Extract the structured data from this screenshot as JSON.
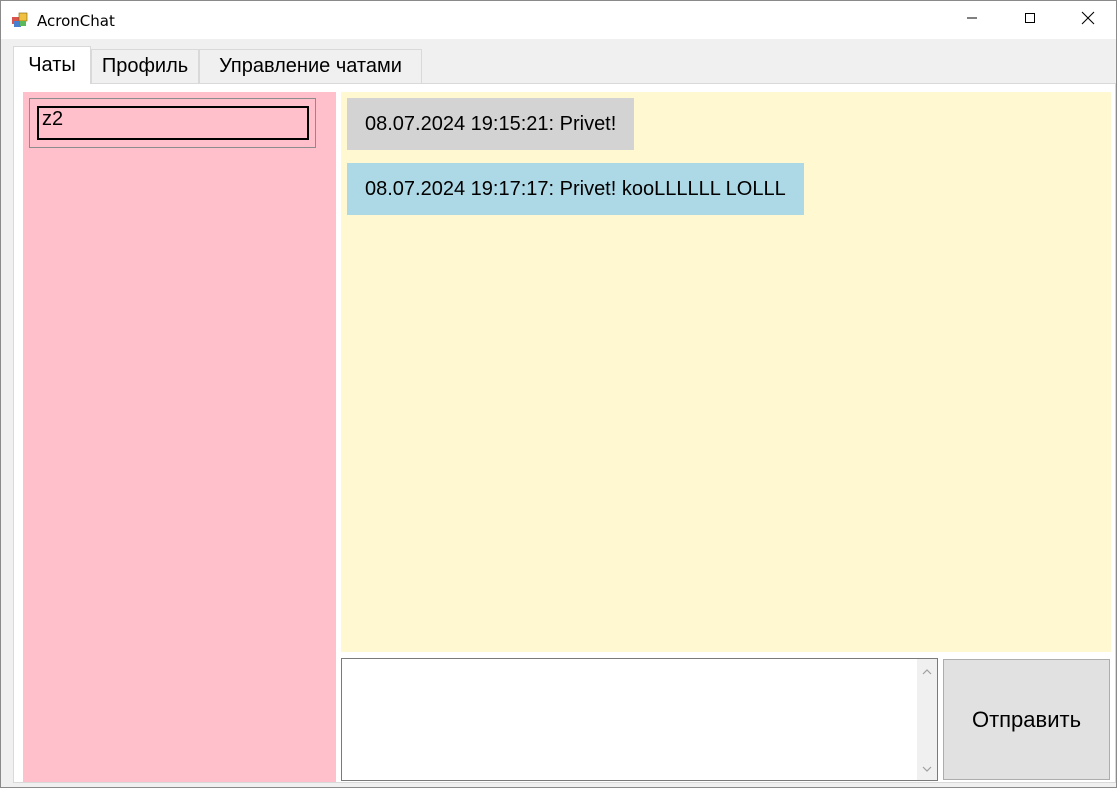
{
  "window": {
    "title": "AcronChat",
    "controls": {
      "minimize_icon": "minimize-icon",
      "maximize_icon": "maximize-icon",
      "close_icon": "close-icon"
    }
  },
  "tabs": [
    {
      "label": "Чаты",
      "active": true
    },
    {
      "label": "Профиль",
      "active": false
    },
    {
      "label": "Управление чатами",
      "active": false
    }
  ],
  "chat_list": {
    "background": "#ffc0cb",
    "items": [
      {
        "label": "z2"
      }
    ]
  },
  "messages": {
    "background": "#fff8d0",
    "items": [
      {
        "text": "08.07.2024 19:15:21: Privet!",
        "color": "#d3d3d3"
      },
      {
        "text": "08.07.2024 19:17:17: Privet! kooLLLLLL LOLLL",
        "color": "#add8e6"
      }
    ]
  },
  "composer": {
    "input_value": "",
    "send_label": "Отправить"
  }
}
